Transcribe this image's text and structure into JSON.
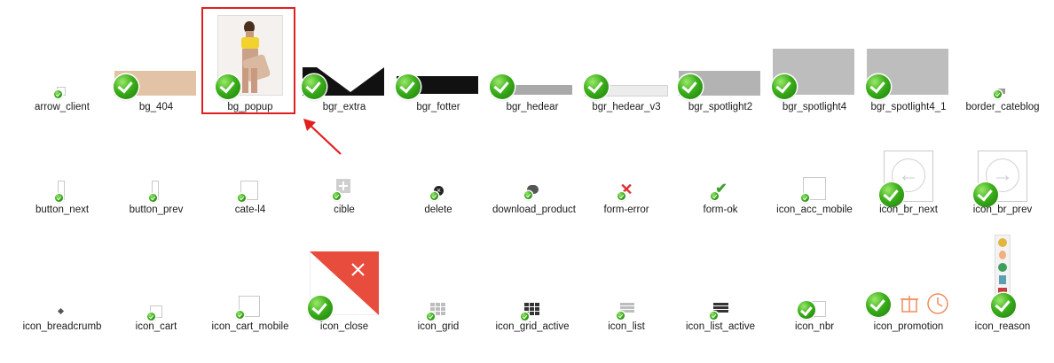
{
  "colors": {
    "selection": "#e02020",
    "check_green": "#2f9e17"
  },
  "selected_item": "bg_popup",
  "annotation": "red-arrow-pointing-to-selected-item",
  "rows": [
    {
      "items": [
        {
          "name": "arrow_client"
        },
        {
          "name": "bg_404"
        },
        {
          "name": "bg_popup"
        },
        {
          "name": "bgr_extra"
        },
        {
          "name": "bgr_fotter"
        },
        {
          "name": "bgr_hedear"
        },
        {
          "name": "bgr_hedear_v3"
        },
        {
          "name": "bgr_spotlight2"
        },
        {
          "name": "bgr_spotlight4"
        },
        {
          "name": "bgr_spotlight4_1"
        },
        {
          "name": "border_cateblog"
        }
      ]
    },
    {
      "items": [
        {
          "name": "button_next"
        },
        {
          "name": "button_prev"
        },
        {
          "name": "cate-l4"
        },
        {
          "name": "cible"
        },
        {
          "name": "delete"
        },
        {
          "name": "download_product"
        },
        {
          "name": "form-error"
        },
        {
          "name": "form-ok"
        },
        {
          "name": "icon_acc_mobile"
        },
        {
          "name": "icon_br_next"
        },
        {
          "name": "icon_br_prev"
        }
      ]
    },
    {
      "items": [
        {
          "name": "icon_breadcrumb"
        },
        {
          "name": "icon_cart"
        },
        {
          "name": "icon_cart_mobile"
        },
        {
          "name": "icon_close"
        },
        {
          "name": "icon_grid"
        },
        {
          "name": "icon_grid_active"
        },
        {
          "name": "icon_list"
        },
        {
          "name": "icon_list_active"
        },
        {
          "name": "icon_nbr"
        },
        {
          "name": "icon_promotion"
        },
        {
          "name": "icon_reason"
        }
      ]
    }
  ]
}
